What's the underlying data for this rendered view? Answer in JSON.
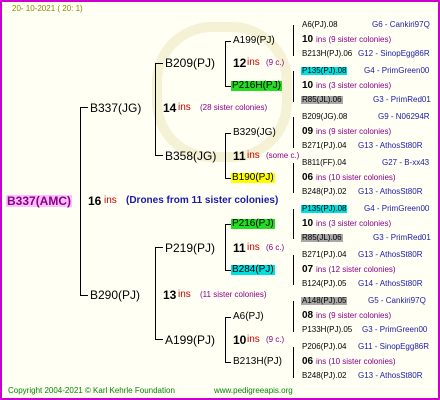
{
  "header": {
    "date": "20- 10-2021 ( 20: 1)"
  },
  "root": {
    "name": "B337(AMC)",
    "count": "16",
    "ins": "ins",
    "desc": "(Drones from 11 sister colonies)"
  },
  "gen1": [
    {
      "name": "B337(JG)",
      "count": "14",
      "ins": "ins",
      "desc": "(28 sister colonies)"
    },
    {
      "name": "B290(PJ)",
      "count": "13",
      "ins": "ins",
      "desc": "(11 sister colonies)"
    }
  ],
  "gen2": [
    {
      "name": "B209(PJ)",
      "count": "12",
      "ins": "ins",
      "desc": "(9 c.)"
    },
    {
      "name": "B358(JG)",
      "count": "11",
      "ins": "ins",
      "desc": "(some c.)"
    },
    {
      "name": "P219(PJ)",
      "count": "11",
      "ins": "ins",
      "desc": "(6 c.)"
    },
    {
      "name": "A199(PJ)",
      "count": "10",
      "ins": "ins",
      "desc": "(9 c.)"
    }
  ],
  "gen3": [
    {
      "name": "A199(PJ)"
    },
    {
      "name": "P216H(PJ)"
    },
    {
      "name": "B329(JG)"
    },
    {
      "name": "B190(PJ)"
    },
    {
      "name": "P216(PJ)"
    },
    {
      "name": "B284(PJ)"
    },
    {
      "name": "A6(PJ)"
    },
    {
      "name": "B213H(PJ)"
    }
  ],
  "gen4": [
    {
      "top": "A6(PJ).08",
      "top_r": "G6 - Cankiri97Q",
      "mid_n": "10",
      "mid_t": "ins (9 sister colonies)",
      "bot": "B213H(PJ).06",
      "bot_r": "G12 - SinopEgg86R"
    },
    {
      "top": "P135(PJ).08",
      "top_r": "G4 - PrimGreen00",
      "mid_n": "10",
      "mid_t": "ins (3 sister colonies)",
      "bot": "R85(JL).06",
      "bot_r": "G3 - PrimRed01"
    },
    {
      "top": "B209(JG).08",
      "top_r": "G9 - N06294R",
      "mid_n": "09",
      "mid_t": "ins (9 sister colonies)",
      "bot": "B271(PJ).04",
      "bot_r": "G13 - AthosSt80R"
    },
    {
      "top": "B811(FF).04",
      "top_r": "G27 - B-xx43",
      "mid_n": "06",
      "mid_t": "ins (10 sister colonies)",
      "bot": "B248(PJ).02",
      "bot_r": "G13 - AthosSt80R"
    },
    {
      "top": "P135(PJ).08",
      "top_r": "G4 - PrimGreen00",
      "mid_n": "10",
      "mid_t": "ins (3 sister colonies)",
      "bot": "R85(JL).06",
      "bot_r": "G3 - PrimRed01"
    },
    {
      "top": "B271(PJ).04",
      "top_r": "G13 - AthosSt80R",
      "mid_n": "07",
      "mid_t": "ins (12 sister colonies)",
      "bot": "B124(PJ).05",
      "bot_r": "G14 - AthosSt80R"
    },
    {
      "top": "A148(PJ).05",
      "top_r": "G5 - Cankiri97Q",
      "mid_n": "08",
      "mid_t": "ins (9 sister colonies)",
      "bot": "P133H(PJ).05",
      "bot_r": "G3 - PrimGreen00"
    },
    {
      "top": "P206(PJ).04",
      "top_r": "G11 - SinopEgg86R",
      "mid_n": "06",
      "mid_t": "ins (10 sister colonies)",
      "bot": "B248(PJ).02",
      "bot_r": "G13 - AthosSt80R"
    }
  ],
  "footer": {
    "copyright": "Copyright 2004-2021 © Karl Kehrle Foundation",
    "site": "www.pedigreeapis.org"
  }
}
